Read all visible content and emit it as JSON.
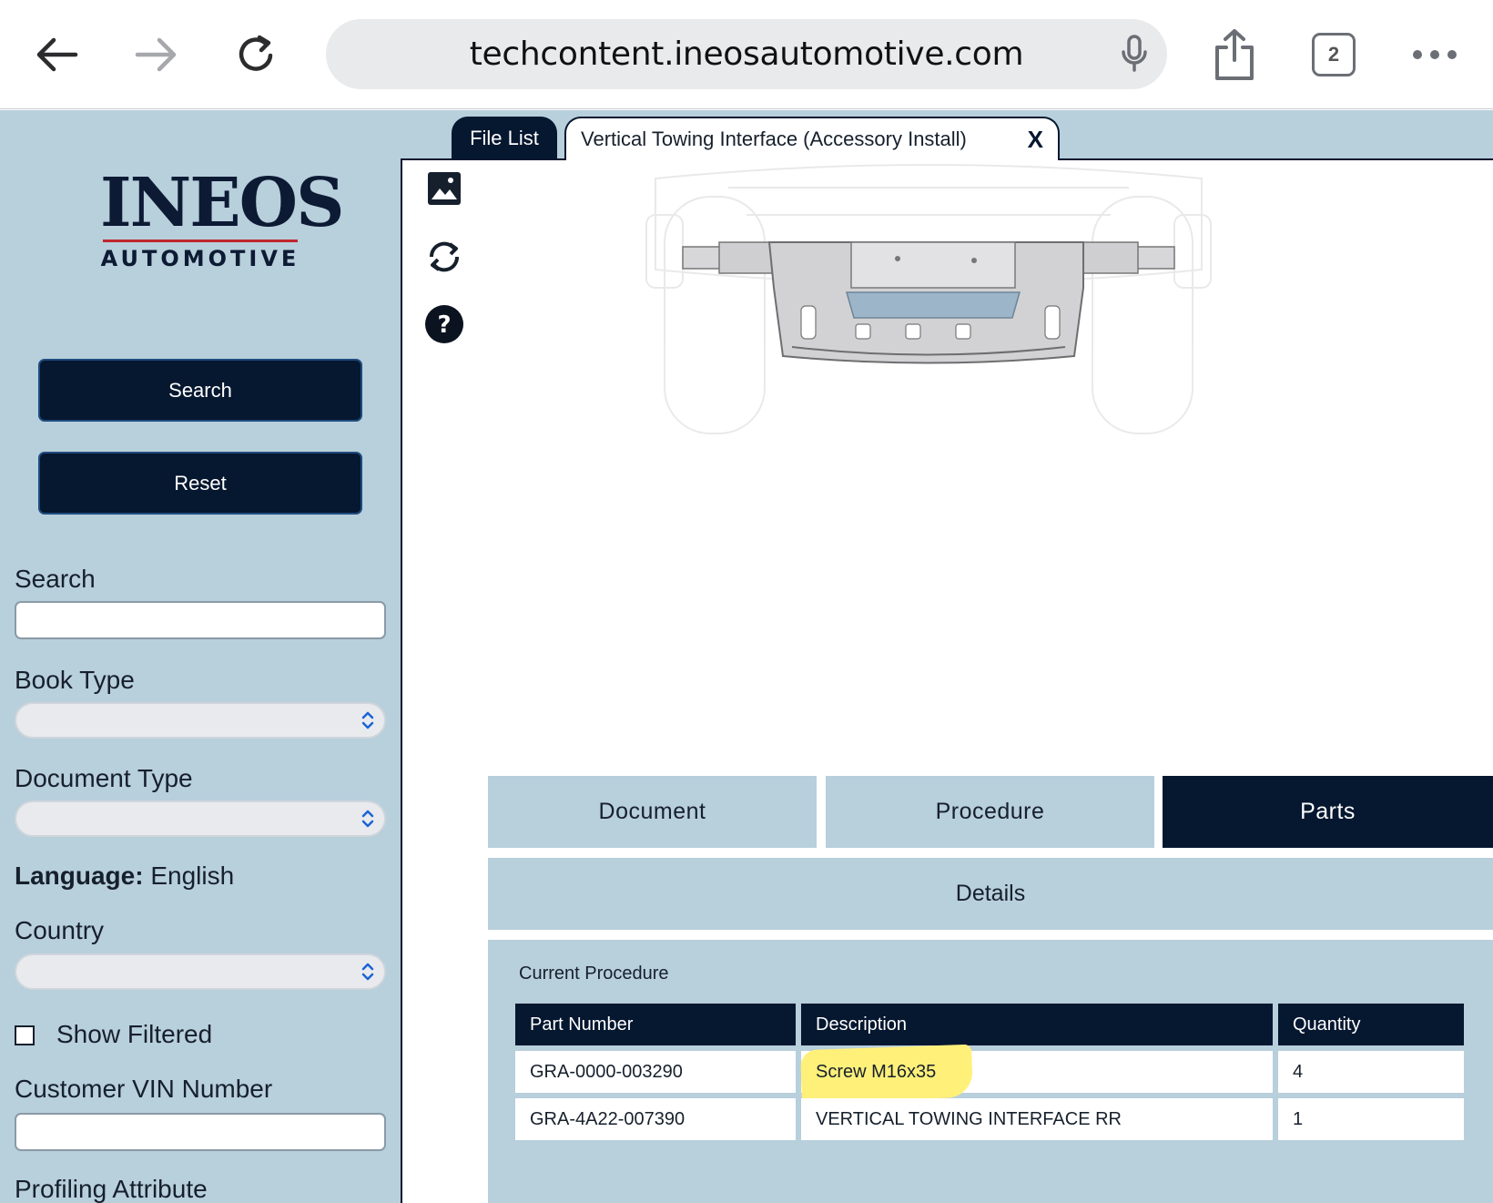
{
  "browser": {
    "url": "techcontent.ineosautomotive.com",
    "tab_count": "2"
  },
  "sidebar": {
    "logo_main": "INEOS",
    "logo_sub": "AUTOMOTIVE",
    "search_button": "Search",
    "reset_button": "Reset",
    "search_label": "Search",
    "search_value": "",
    "book_type_label": "Book Type",
    "book_type_value": "",
    "document_type_label": "Document Type",
    "document_type_value": "",
    "language_label": "Language:",
    "language_value": "English",
    "country_label": "Country",
    "country_value": "",
    "show_filtered_label": "Show Filtered",
    "show_filtered_checked": false,
    "vin_label": "Customer VIN Number",
    "vin_value": "",
    "profiling_label": "Profiling Attribute"
  },
  "tabs": {
    "file_list": "File List",
    "active_title": "Vertical Towing Interface (Accessory Install)",
    "close": "X"
  },
  "toolbar_icons": [
    "image-icon",
    "rotate-icon",
    "help-icon"
  ],
  "sections": {
    "document": "Document",
    "procedure": "Procedure",
    "parts": "Parts",
    "active": "Parts",
    "details": "Details"
  },
  "parts_table": {
    "title": "Current Procedure",
    "headers": [
      "Part Number",
      "Description",
      "Quantity"
    ],
    "rows": [
      [
        "GRA-0000-003290",
        "Screw M16x35",
        "4"
      ],
      [
        "GRA-4A22-007390",
        "VERTICAL TOWING INTERFACE RR",
        "1"
      ]
    ],
    "highlight_color": "#fff07a"
  },
  "colors": {
    "navy": "#061730",
    "panel_blue": "#b8cfdc",
    "logo_red": "#c0272d"
  }
}
